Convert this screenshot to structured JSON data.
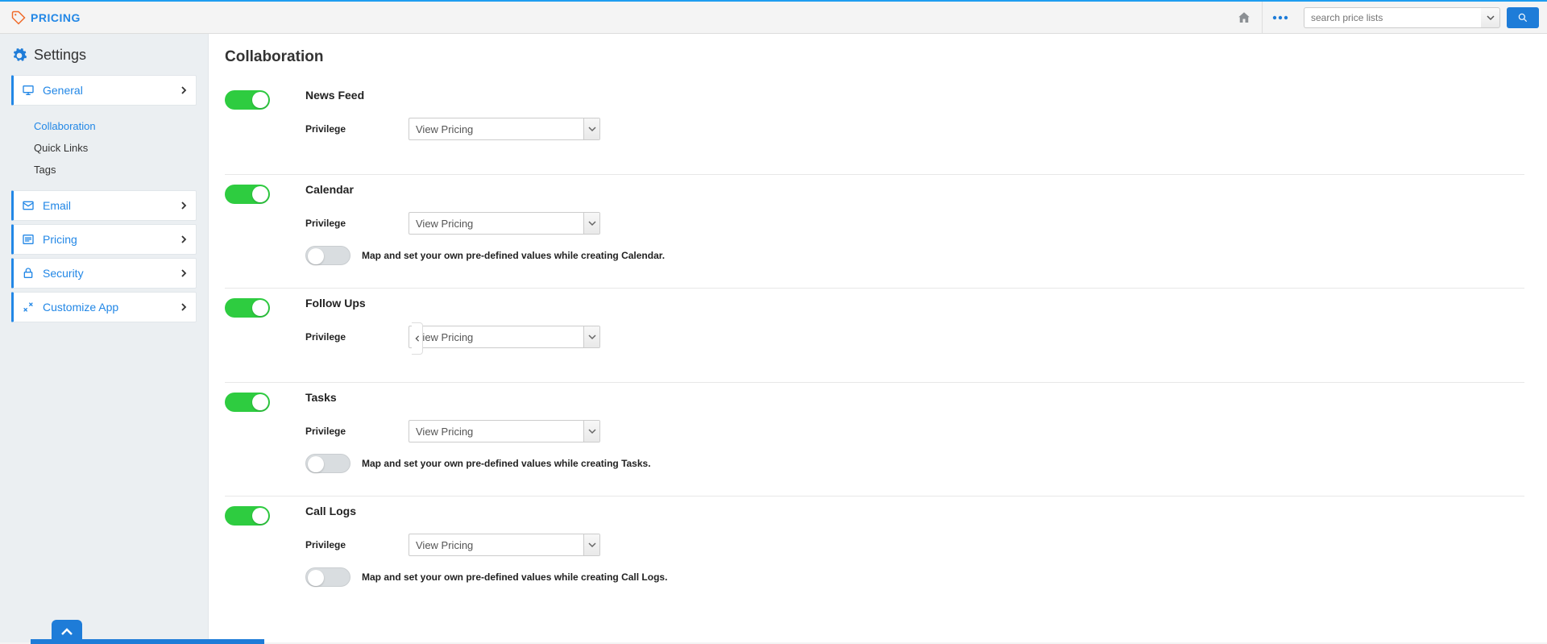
{
  "header": {
    "brand": "PRICING",
    "search_placeholder": "search price lists"
  },
  "sidebar": {
    "title": "Settings",
    "items": [
      {
        "label": "General",
        "icon": "monitor"
      },
      {
        "label": "Email",
        "icon": "mail"
      },
      {
        "label": "Pricing",
        "icon": "list"
      },
      {
        "label": "Security",
        "icon": "lock"
      },
      {
        "label": "Customize App",
        "icon": "tools"
      }
    ],
    "sub": {
      "collaboration": "Collaboration",
      "quick_links": "Quick Links",
      "tags": "Tags"
    }
  },
  "page": {
    "title": "Collaboration",
    "privilege_label": "Privilege",
    "privilege_value": "View Pricing",
    "sections": [
      {
        "title": "News Feed",
        "has_map": false,
        "map_text": ""
      },
      {
        "title": "Calendar",
        "has_map": true,
        "map_text": "Map and set your own pre-defined values while creating Calendar."
      },
      {
        "title": "Follow Ups",
        "has_map": false,
        "map_text": ""
      },
      {
        "title": "Tasks",
        "has_map": true,
        "map_text": "Map and set your own pre-defined values while creating Tasks."
      },
      {
        "title": "Call Logs",
        "has_map": true,
        "map_text": "Map and set your own pre-defined values while creating Call Logs."
      }
    ]
  }
}
